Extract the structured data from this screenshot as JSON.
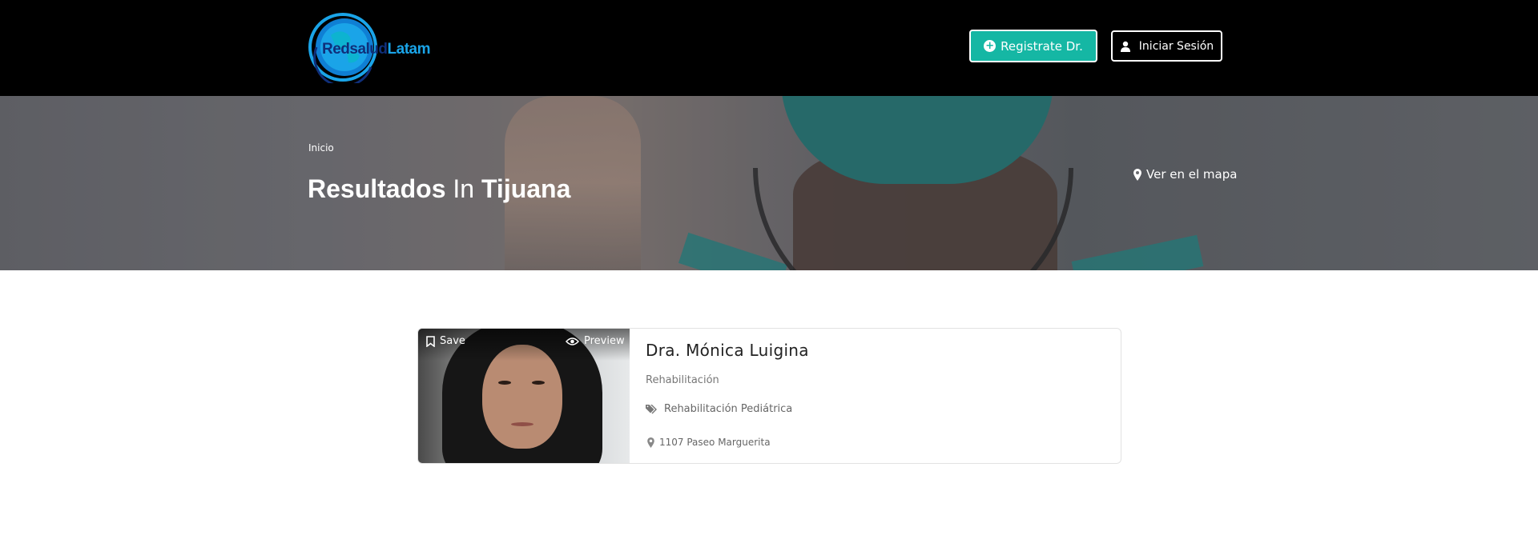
{
  "header": {
    "logo": {
      "part1": "Redsalud",
      "part2": "Latam"
    },
    "register_button": "Registrate Dr.",
    "login_button": "Iniciar Sesión"
  },
  "hero": {
    "breadcrumb": "Inicio",
    "title_prefix": "Resultados",
    "title_connector": "In",
    "title_city": "Tijuana",
    "map_link": "Ver en el mapa"
  },
  "results": [
    {
      "save_label": "Save",
      "preview_label": "Preview",
      "name": "Dra. Mónica Luigina",
      "specialty": "Rehabilitación",
      "tag": "Rehabilitación Pediátrica",
      "address": "1107 Paseo Marguerita"
    }
  ],
  "colors": {
    "header_bg": "#000000",
    "accent": "#15b7a4",
    "logo_dark": "#0f2f7a",
    "logo_light": "#1aa4e8"
  }
}
